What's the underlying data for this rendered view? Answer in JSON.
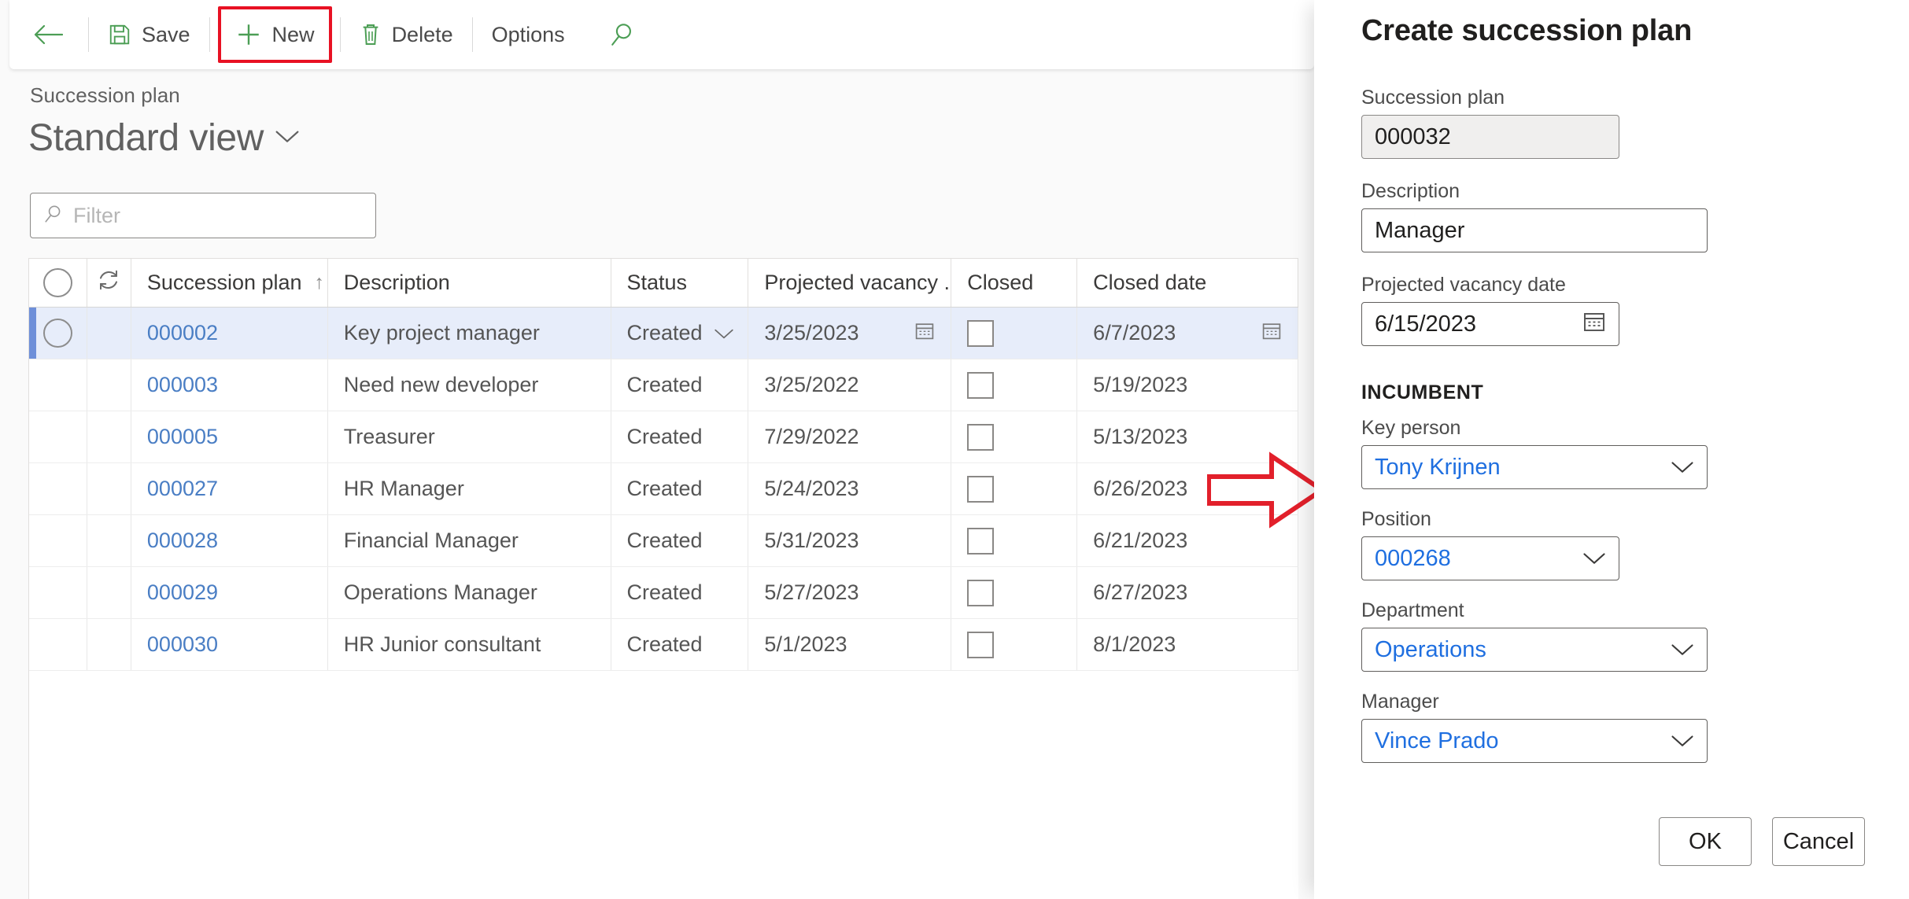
{
  "toolbar": {
    "back_icon": "back-arrow-icon",
    "save_label": "Save",
    "new_label": "New",
    "delete_label": "Delete",
    "options_label": "Options",
    "search_icon": "search-icon",
    "highlight_color": "#e81123",
    "icon_color": "#4c9e55"
  },
  "page": {
    "breadcrumb": "Succession plan",
    "view_title": "Standard view",
    "view_chevron": "chevron-down-icon"
  },
  "filter": {
    "icon": "search-icon",
    "placeholder": "Filter",
    "value": ""
  },
  "grid": {
    "columns": [
      {
        "key": "select",
        "label": ""
      },
      {
        "key": "refresh",
        "label": ""
      },
      {
        "key": "plan",
        "label": "Succession plan",
        "sort": "↑"
      },
      {
        "key": "desc",
        "label": "Description"
      },
      {
        "key": "status",
        "label": "Status"
      },
      {
        "key": "proj",
        "label": "Projected vacancy ..."
      },
      {
        "key": "closed",
        "label": "Closed"
      },
      {
        "key": "cdate",
        "label": "Closed date"
      }
    ],
    "rows": [
      {
        "plan": "000002",
        "desc": "Key project manager",
        "status": "Created",
        "proj": "3/25/2023",
        "closed": false,
        "cdate": "6/7/2023",
        "selected": true
      },
      {
        "plan": "000003",
        "desc": "Need new developer",
        "status": "Created",
        "proj": "3/25/2022",
        "closed": false,
        "cdate": "5/19/2023",
        "selected": false
      },
      {
        "plan": "000005",
        "desc": "Treasurer",
        "status": "Created",
        "proj": "7/29/2022",
        "closed": false,
        "cdate": "5/13/2023",
        "selected": false
      },
      {
        "plan": "000027",
        "desc": "HR Manager",
        "status": "Created",
        "proj": "5/24/2023",
        "closed": false,
        "cdate": "6/26/2023",
        "selected": false
      },
      {
        "plan": "000028",
        "desc": "Financial Manager",
        "status": "Created",
        "proj": "5/31/2023",
        "closed": false,
        "cdate": "6/21/2023",
        "selected": false
      },
      {
        "plan": "000029",
        "desc": "Operations Manager",
        "status": "Created",
        "proj": "5/27/2023",
        "closed": false,
        "cdate": "6/27/2023",
        "selected": false
      },
      {
        "plan": "000030",
        "desc": "HR Junior consultant",
        "status": "Created",
        "proj": "5/1/2023",
        "closed": false,
        "cdate": "8/1/2023",
        "selected": false
      }
    ]
  },
  "annotation": {
    "arrow_color": "#e81123",
    "arrow_direction": "right"
  },
  "panel": {
    "title": "Create succession plan",
    "section_incumbent": "INCUMBENT",
    "fields": {
      "succession_plan": {
        "label": "Succession plan",
        "value": "000032"
      },
      "description": {
        "label": "Description",
        "value": "Manager"
      },
      "projected_vacancy_date": {
        "label": "Projected vacancy date",
        "value": "6/15/2023",
        "icon": "calendar-icon"
      },
      "key_person": {
        "label": "Key person",
        "value": "Tony Krijnen"
      },
      "position": {
        "label": "Position",
        "value": "000268"
      },
      "department": {
        "label": "Department",
        "value": "Operations"
      },
      "manager": {
        "label": "Manager",
        "value": "Vince Prado"
      }
    },
    "ok_label": "OK",
    "cancel_label": "Cancel"
  }
}
